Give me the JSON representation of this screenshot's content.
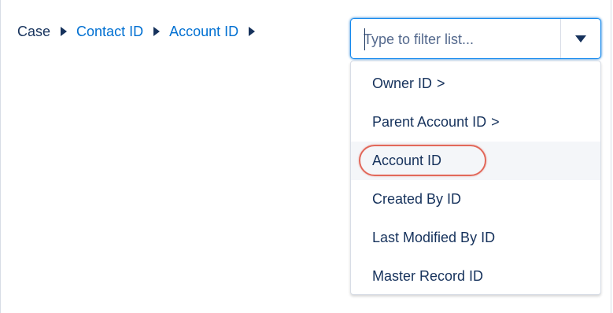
{
  "breadcrumb": {
    "items": [
      {
        "label": "Case"
      },
      {
        "label": "Contact ID"
      },
      {
        "label": "Account ID"
      }
    ]
  },
  "filter": {
    "placeholder": "Type to filter list..."
  },
  "dropdown": {
    "items": [
      {
        "label": "Owner ID",
        "chevron": ">"
      },
      {
        "label": "Parent Account ID",
        "chevron": ">"
      },
      {
        "label": "Account ID",
        "chevron": ""
      },
      {
        "label": "Created By ID",
        "chevron": ""
      },
      {
        "label": "Last Modified By ID",
        "chevron": ""
      },
      {
        "label": "Master Record ID",
        "chevron": ""
      }
    ]
  },
  "colors": {
    "link": "#0070d2",
    "text": "#16325c",
    "focus_border": "#1589ee",
    "hover_row": "#f4f6f9",
    "annotation": "#e2685a"
  },
  "icons": {
    "separator": "right-triangle-icon",
    "toggle": "down-triangle-icon"
  }
}
